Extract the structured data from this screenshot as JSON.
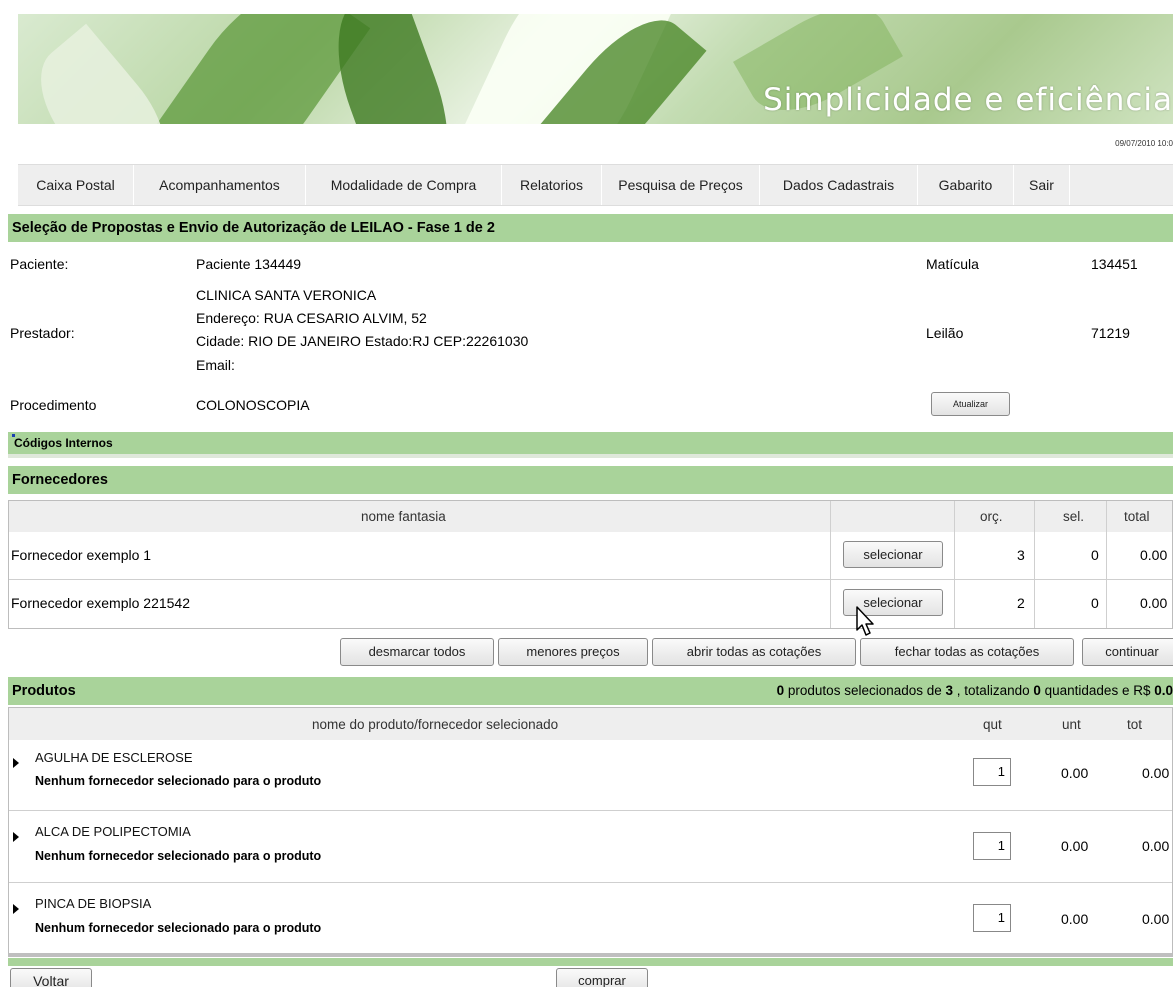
{
  "banner": {
    "title": "Simplicidade e eficiência"
  },
  "datetime": "09/07/2010 10:0",
  "nav": [
    "Caixa Postal",
    "Acompanhamentos",
    "Modalidade de Compra",
    "Relatorios",
    "Pesquisa de Preços",
    "Dados Cadastrais",
    "Gabarito",
    "Sair"
  ],
  "header_bar": "Seleção de Propostas e Envio de Autorização de LEILAO - Fase 1 de 2",
  "info": {
    "paciente_label": "Paciente:",
    "paciente_value": "Paciente 134449",
    "matricula_label": "Matícula",
    "matricula_value": "134451",
    "prestador_label": "Prestador:",
    "prestador_lines": [
      "CLINICA SANTA VERONICA",
      "Endereço: RUA CESARIO ALVIM, 52",
      "Cidade: RIO DE JANEIRO Estado:RJ CEP:22261030",
      "Email:"
    ],
    "leilao_label": "Leilão",
    "leilao_value": "71219",
    "procedimento_label": "Procedimento",
    "procedimento_value": "COLONOSCOPIA",
    "atualizar_label": "Atualizar"
  },
  "codigos_internos": "Códigos Internos",
  "fornecedores": {
    "title": "Fornecedores",
    "headers": {
      "nome": "nome fantasia",
      "orc": "orç.",
      "sel": "sel.",
      "total": "total"
    },
    "rows": [
      {
        "nome": "Fornecedor exemplo 1",
        "button": "selecionar",
        "orc": "3",
        "sel": "0",
        "total": "0.00"
      },
      {
        "nome": "Fornecedor exemplo 221542",
        "button": "selecionar",
        "orc": "2",
        "sel": "0",
        "total": "0.00"
      }
    ],
    "actions": [
      "desmarcar todos",
      "menores preços",
      "abrir todas as cotações",
      "fechar todas as cotações",
      "continuar"
    ]
  },
  "produtos": {
    "title": "Produtos",
    "summary": {
      "count": "0",
      "t1": " produtos selecionados de ",
      "total": "3",
      "t2": " , totalizando ",
      "qtd": "0",
      "t3": " quantidades e R$ ",
      "valor": "0.0"
    },
    "headers": {
      "nome": "nome do produto/fornecedor selecionado",
      "qut": "qut",
      "unt": "unt",
      "tot": "tot"
    },
    "rows": [
      {
        "nome": "AGULHA DE ESCLEROSE",
        "note": "Nenhum fornecedor selecionado para o produto",
        "qut": "1",
        "unt": "0.00",
        "tot": "0.00"
      },
      {
        "nome": "ALCA DE POLIPECTOMIA",
        "note": "Nenhum fornecedor selecionado para o produto",
        "qut": "1",
        "unt": "0.00",
        "tot": "0.00"
      },
      {
        "nome": "PINCA DE BIOPSIA",
        "note": "Nenhum fornecedor selecionado para o produto",
        "qut": "1",
        "unt": "0.00",
        "tot": "0.00"
      }
    ]
  },
  "footer": {
    "voltar": "Voltar",
    "comprar": "comprar"
  }
}
